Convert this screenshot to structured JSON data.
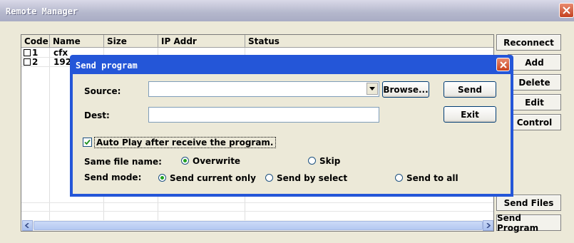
{
  "window": {
    "title": "Remote Manager"
  },
  "table": {
    "columns": [
      "Code",
      "Name",
      "Size",
      "IP Addr",
      "Status"
    ],
    "rows": [
      {
        "code": "1",
        "name": "cfx"
      },
      {
        "code": "2",
        "name": "192."
      }
    ]
  },
  "right_buttons": {
    "reconnect": "Reconnect",
    "add": "Add",
    "delete": "Delete",
    "edit": "Edit",
    "control": "Control",
    "send_files": "Send Files",
    "send_program": "Send Program"
  },
  "dialog": {
    "title": "Send program",
    "source_label": "Source:",
    "source_value": "",
    "browse": "Browse...",
    "send": "Send",
    "dest_label": "Dest:",
    "dest_value": "",
    "exit": "Exit",
    "auto_play": {
      "label": "Auto Play after receive the program.",
      "checked": true
    },
    "same_file_name": {
      "label": "Same file name:",
      "options": [
        "Overwrite",
        "Skip"
      ],
      "selected": "Overwrite"
    },
    "send_mode": {
      "label": "Send mode:",
      "options": [
        "Send current only",
        "Send by select",
        "Send to all"
      ],
      "selected": "Send current only"
    }
  },
  "colors": {
    "dialog_frame": "#2456d8",
    "window_face": "#ece9d8",
    "close_red": "#c4401f"
  }
}
